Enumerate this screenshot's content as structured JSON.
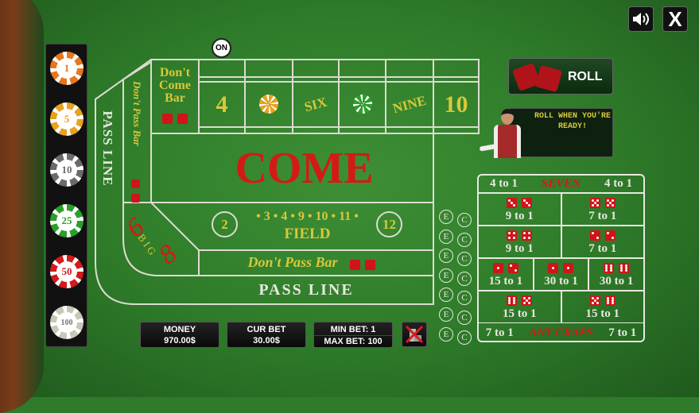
{
  "top_controls": {
    "sound_icon": "speaker-icon",
    "close_label": "X"
  },
  "chips": [
    {
      "value": "1",
      "color": "#e8761c"
    },
    {
      "value": "5",
      "color": "#e8a21c"
    },
    {
      "value": "10",
      "color": "#6b6b6b"
    },
    {
      "value": "25",
      "color": "#2aa02a"
    },
    {
      "value": "50",
      "color": "#d41a1a"
    },
    {
      "value": "100",
      "color": "#c8c8b8"
    }
  ],
  "puck": "ON",
  "table": {
    "pass_line_side": "PASS LINE",
    "dont_pass_bar_side": "Don't Pass Bar",
    "dont_come_bar": "Don't\nCome\nBar",
    "points": [
      "4",
      "5",
      "SIX",
      "25",
      "NINE",
      "10"
    ],
    "come": "COME",
    "field_numbers": "• 3 • 4 • 9 • 10 • 11 •",
    "field_2": "2",
    "field_12": "12",
    "field": "FIELD",
    "dont_pass_bar": "Don't Pass Bar",
    "pass_line": "PASS LINE",
    "big6": "6",
    "big8": "8",
    "big": "B I G",
    "e": "E",
    "c": "C"
  },
  "roll_button": "ROLL",
  "dealer_message": "ROLL WHEN YOU'RE READY!",
  "props": {
    "seven_left": "4 to 1",
    "seven": "SEVEN",
    "seven_right": "4 to 1",
    "cells": [
      {
        "dice": [
          3,
          3
        ],
        "odds": "9 to 1"
      },
      {
        "dice": [
          5,
          5
        ],
        "odds": "7 to 1"
      },
      {
        "dice": [
          4,
          4
        ],
        "odds": "9 to 1"
      },
      {
        "dice": [
          2,
          2
        ],
        "odds": "7 to 1"
      },
      {
        "dice": [
          1,
          2
        ],
        "odds": "15 to 1"
      },
      {
        "dice": [
          1,
          1
        ],
        "odds": "30 to 1"
      },
      {
        "dice": [
          6,
          6
        ],
        "odds": "30 to 1"
      },
      {
        "dice": [
          6,
          5
        ],
        "odds": "15 to 1"
      },
      {
        "dice": [
          5,
          6
        ],
        "odds": "15 to 1"
      }
    ],
    "craps_left": "7 to 1",
    "any_craps": "ANY CRAPS",
    "craps_right": "7 to 1"
  },
  "status": {
    "money_label": "MONEY",
    "money": "970.00$",
    "curbet_label": "CUR BET",
    "curbet": "30.00$",
    "minbet": "MIN BET: 1",
    "maxbet": "MAX BET: 100",
    "clear_icon": "clear-bets-icon"
  },
  "bets_on_table": [
    {
      "place": "5",
      "chip": "5"
    },
    {
      "place": "8",
      "chip": "25"
    }
  ]
}
